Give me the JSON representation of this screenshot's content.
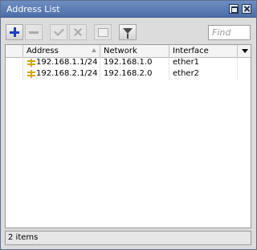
{
  "window": {
    "title": "Address List"
  },
  "titlebar": {
    "buttons": [
      "maximize-icon",
      "close-icon"
    ]
  },
  "toolbar": {
    "tools": [
      {
        "name": "add-icon",
        "enabled": true
      },
      {
        "name": "remove-icon",
        "enabled": false
      },
      {
        "name": "enable-icon",
        "enabled": false
      },
      {
        "name": "disable-icon",
        "enabled": false
      },
      {
        "name": "comment-icon",
        "enabled": false
      },
      {
        "name": "filter-icon",
        "enabled": true
      }
    ],
    "find_placeholder": "Find"
  },
  "table": {
    "columns": [
      "Address",
      "Network",
      "Interface"
    ],
    "sorted_column": "Address",
    "rows": [
      {
        "address": "192.168.1.1/24",
        "network": "192.168.1.0",
        "interface": "ether1"
      },
      {
        "address": "192.168.2.1/24",
        "network": "192.168.2.0",
        "interface": "ether2"
      }
    ]
  },
  "status": {
    "text": "2 items"
  },
  "colors": {
    "titlebar": "#5a7cb6",
    "add_icon": "#1a3ec9",
    "address_icon": "#d4a700"
  }
}
